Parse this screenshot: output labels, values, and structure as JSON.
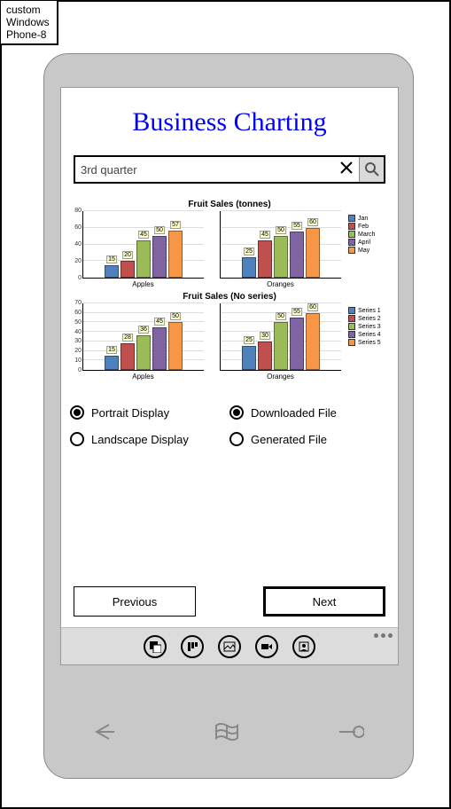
{
  "window": {
    "tab_title": "custom Windows Phone-8"
  },
  "header": {
    "title": "Business Charting"
  },
  "search": {
    "value": "3rd quarter"
  },
  "chart_data": [
    {
      "type": "bar",
      "title": "Fruit Sales (tonnes)",
      "ylim": [
        0,
        80
      ],
      "yticks": [
        0,
        20,
        40,
        60,
        80
      ],
      "legend": [
        "Jan",
        "Feb",
        "March",
        "April",
        "May"
      ],
      "panels": [
        {
          "xlabel": "Apples",
          "values": [
            15,
            20,
            45,
            50,
            57
          ]
        },
        {
          "xlabel": "Oranges",
          "values": [
            25,
            45,
            50,
            55,
            60
          ]
        }
      ],
      "colors": [
        "#4f81bd",
        "#c0504d",
        "#9bbb59",
        "#8064a2",
        "#f79646"
      ]
    },
    {
      "type": "bar",
      "title": "Fruit Sales (No series)",
      "ylim": [
        0,
        70
      ],
      "yticks": [
        0,
        10,
        20,
        30,
        40,
        50,
        60,
        70
      ],
      "legend": [
        "Series 1",
        "Series 2",
        "Series 3",
        "Series 4",
        "Series 5"
      ],
      "panels": [
        {
          "xlabel": "Apples",
          "values": [
            15,
            28,
            36,
            45,
            50
          ]
        },
        {
          "xlabel": "Oranges",
          "values": [
            25,
            30,
            50,
            55,
            60
          ]
        }
      ],
      "colors": [
        "#4f81bd",
        "#c0504d",
        "#9bbb59",
        "#8064a2",
        "#f79646"
      ]
    }
  ],
  "radios": {
    "portrait": {
      "label": "Portrait Display",
      "checked": true
    },
    "landscape": {
      "label": "Landscape Display",
      "checked": false
    },
    "downloaded": {
      "label": "Downloaded File",
      "checked": true
    },
    "generated": {
      "label": "Generated File",
      "checked": false
    }
  },
  "nav": {
    "prev": "Previous",
    "next": "Next"
  },
  "appbar": {
    "icons": [
      "add",
      "align",
      "image",
      "video",
      "contact"
    ]
  }
}
